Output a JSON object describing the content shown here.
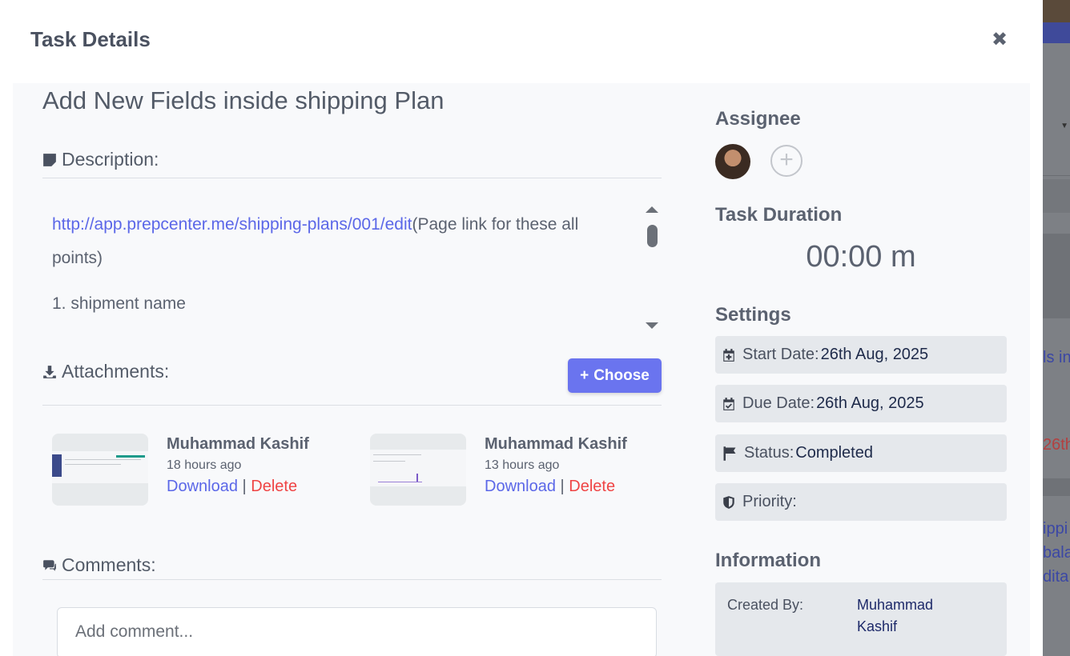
{
  "modal": {
    "title": "Task Details",
    "close_icon": "close-icon"
  },
  "task": {
    "title": "Add New Fields inside shipping Plan"
  },
  "description": {
    "heading": "Description:",
    "link": "http://app.prepcenter.me/shipping-plans/001/edit",
    "link_suffix": "(Page link for these all points)",
    "list_item_1": "1.  shipment name"
  },
  "attachments": {
    "heading": "Attachments:",
    "choose_label": "Choose",
    "items": [
      {
        "name": "Muhammad Kashif",
        "time": "18 hours ago",
        "download": "Download",
        "separator": "|",
        "delete": "Delete"
      },
      {
        "name": "Muhammad Kashif",
        "time": "13 hours ago",
        "download": "Download",
        "separator": "|",
        "delete": "Delete"
      }
    ]
  },
  "comments": {
    "heading": "Comments:",
    "placeholder": "Add comment..."
  },
  "assignee": {
    "heading": "Assignee"
  },
  "duration": {
    "heading": "Task Duration",
    "value": "00:00 m"
  },
  "settings": {
    "heading": "Settings",
    "start_label": "Start Date:",
    "start_value": "26th Aug, 2025",
    "due_label": "Due Date:",
    "due_value": "26th Aug, 2025",
    "status_label": "Status:",
    "status_value": "Completed",
    "priority_label": "Priority:"
  },
  "information": {
    "heading": "Information",
    "created_by_label": "Created By:",
    "created_by_value": "Muhammad Kashif"
  },
  "background": {
    "peek_1": "ls in",
    "peek_2": "26th",
    "peek_3": "ippi",
    "peek_4": "bala",
    "peek_5": "dita"
  },
  "colors": {
    "accent": "#6a74ef",
    "link": "#5b67e8",
    "danger": "#ef4444"
  }
}
